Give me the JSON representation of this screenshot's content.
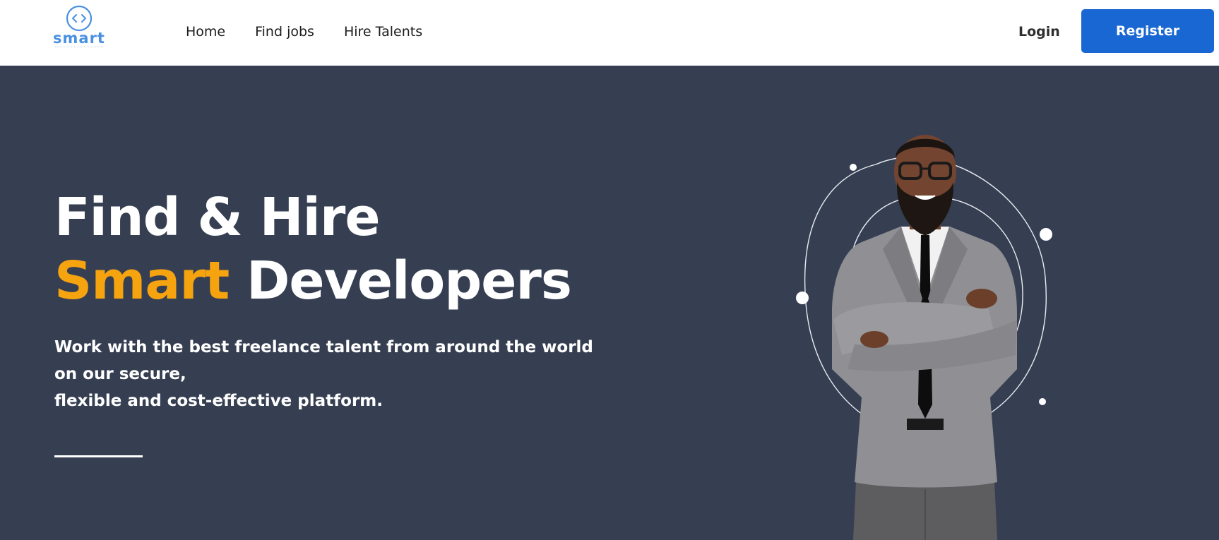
{
  "brand": {
    "name": "smart",
    "logo_icon": "code-brackets-icon",
    "accent_color": "#4a90e2"
  },
  "nav": {
    "links": [
      "Home",
      "Find jobs",
      "Hire Talents"
    ],
    "login_label": "Login",
    "register_label": "Register",
    "register_color": "#1967d2"
  },
  "hero": {
    "title_line1": "Find & Hire",
    "title_accent": "Smart",
    "title_line2_rest": "Developers",
    "subtitle_line1": "Work with the best freelance talent from around the world",
    "subtitle_line2": "on our secure,",
    "subtitle_line3": "flexible and cost-effective platform.",
    "background_color": "#363f52",
    "accent_color": "#f5a30f"
  }
}
